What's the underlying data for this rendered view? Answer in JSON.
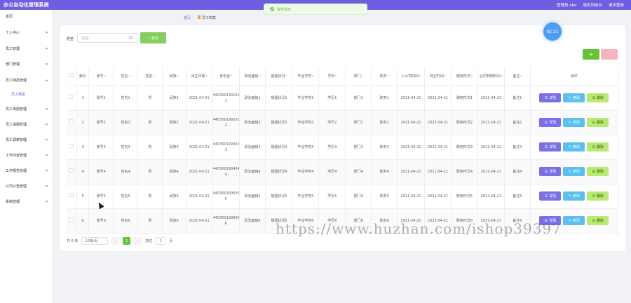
{
  "header": {
    "app_title": "办公自动化管理系统",
    "user": "管理员 abo",
    "back_front": "退出到前台",
    "logout": "退出登录"
  },
  "toast": {
    "message": "操作成功"
  },
  "timer": {
    "text": "02:31"
  },
  "sidebar": {
    "items": [
      {
        "label": "首页"
      },
      {
        "label": "个人中心"
      },
      {
        "label": "员工管理"
      },
      {
        "label": "部门管理"
      },
      {
        "label": "员工档案管理"
      },
      {
        "label": "员工档案"
      },
      {
        "label": "员工考勤管理"
      },
      {
        "label": "员工请假管理"
      },
      {
        "label": "员工调薪管理"
      },
      {
        "label": "工作内容管理"
      },
      {
        "label": "工作报告管理"
      },
      {
        "label": "公司公告管理"
      },
      {
        "label": "系统管理"
      }
    ]
  },
  "breadcrumb": {
    "home": "首页",
    "current": "员工档案"
  },
  "search": {
    "label": "姓名",
    "placeholder": "姓名",
    "button": "查询"
  },
  "toolbar": {
    "add": "+",
    "delete": "-"
  },
  "table": {
    "headers": [
      "索引",
      "账号",
      "姓名",
      "性别",
      "民族",
      "出生日期",
      "身份证",
      "政治面貌",
      "婚姻状况",
      "毕业学校",
      "学历",
      "部门",
      "职务",
      "入公司时间",
      "转正时间",
      "聘用形式",
      "合同到期时间",
      "备注",
      "操作"
    ],
    "rows": [
      [
        "1",
        "账号1",
        "姓名1",
        "男",
        "民族1",
        "2021-04-21",
        "44030019910101000 1",
        "政治面貌1",
        "婚姻状况1",
        "毕业学校1",
        "学历1",
        "部门1",
        "职务1",
        "2021-04-21",
        "2021-04-21",
        "聘用形式1",
        "2021-04-21",
        "备注1"
      ],
      [
        "2",
        "账号2",
        "姓名2",
        "男",
        "民族2",
        "2021-04-21",
        "44030019920202000 2",
        "政治面貌2",
        "婚姻状况2",
        "毕业学校2",
        "学历2",
        "部门2",
        "职务2",
        "2021-04-21",
        "2021-04-21",
        "聘用形式2",
        "2021-04-21",
        "备注2"
      ],
      [
        "3",
        "账号3",
        "姓名3",
        "男",
        "民族3",
        "2021-04-21",
        "44030019930300000 3",
        "政治面貌3",
        "婚姻状况3",
        "毕业学校3",
        "学历3",
        "部门3",
        "职务3",
        "2021-04-21",
        "2021-04-21",
        "聘用形式3",
        "2021-04-21",
        "备注3"
      ],
      [
        "4",
        "账号4",
        "姓名4",
        "男",
        "民族4",
        "2021-04-21",
        "44030019940404000 4",
        "政治面貌4",
        "婚姻状况4",
        "毕业学校4",
        "学历4",
        "部门4",
        "职务4",
        "2021-04-21",
        "2021-04-21",
        "聘用形式4",
        "2021-04-21",
        "备注4"
      ],
      [
        "5",
        "账号5",
        "姓名5",
        "男",
        "民族5",
        "2021-04-21",
        "44030019950505000 5",
        "政治面貌5",
        "婚姻状况5",
        "毕业学校5",
        "学历5",
        "部门5",
        "职务5",
        "2021-04-21",
        "2021-04-21",
        "聘用形式5",
        "2021-04-21",
        "备注5"
      ],
      [
        "6",
        "账号6",
        "姓名6",
        "男",
        "民族6",
        "2021-04-21",
        "44030019960606000 6",
        "政治面貌6",
        "婚姻状况6",
        "毕业学校6",
        "学历6",
        "部门6",
        "职务6",
        "2021-04-21",
        "2021-04-21",
        "聘用形式6",
        "2021-04-21",
        "备注6"
      ]
    ],
    "actions": {
      "detail": "详情",
      "edit": "修改",
      "remove": "删除"
    }
  },
  "pagination": {
    "total": "共 6 条",
    "page_size": "10条/页",
    "current": "1",
    "goto_label": "前往",
    "goto_value": "1",
    "page_unit": "页"
  },
  "watermark": "https://www.huzhan.com/ishop39397",
  "colors": {
    "accent": "#6f5fe0",
    "success": "#67c23a",
    "info": "#5bc0f0"
  }
}
